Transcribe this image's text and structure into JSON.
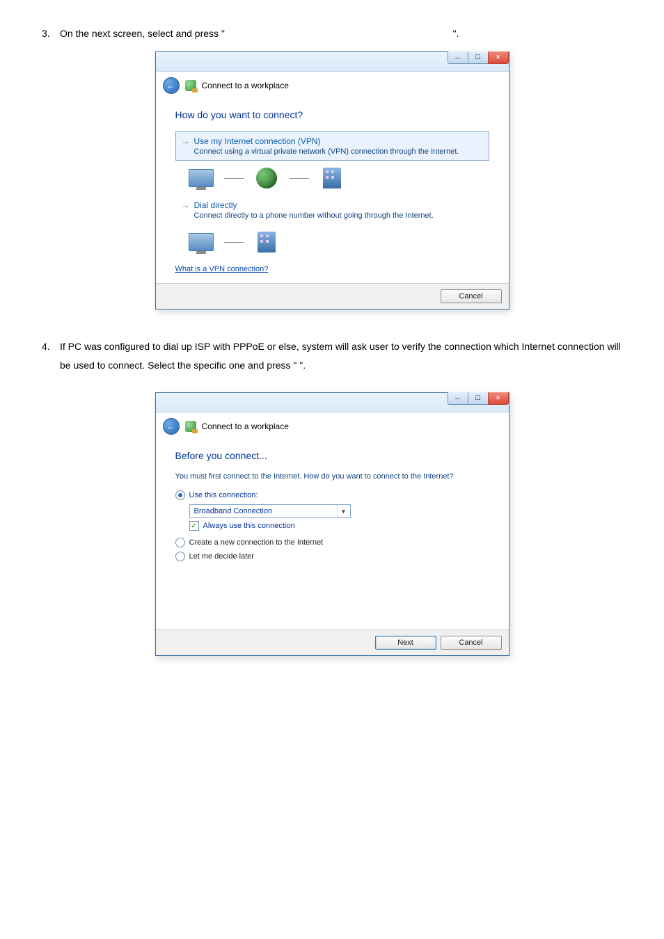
{
  "doc": {
    "item3_num": "3.",
    "item3_text_a": "On the next screen, select and press \"",
    "item3_text_b": "\".",
    "item4_num": "4.",
    "item4_text": "If PC was configured to dial up ISP with PPPoE or else, system will ask user to verify the connection which Internet connection will be used to connect. Select the specific one and press \"        \"."
  },
  "dialog1": {
    "crumb": "Connect to a workplace",
    "heading": "How do you want to connect?",
    "opt1_title": "Use my Internet connection (VPN)",
    "opt1_desc": "Connect using a virtual private network (VPN) connection through the Internet.",
    "opt2_title": "Dial directly",
    "opt2_desc": "Connect directly to a phone number without going through the Internet.",
    "link": "What is a VPN connection?",
    "cancel": "Cancel"
  },
  "dialog2": {
    "crumb": "Connect to a workplace",
    "heading": "Before you connect...",
    "sub": "You must first connect to the Internet. How do you want to connect to the Internet?",
    "r1": "Use this connection:",
    "combo": "Broadband Connection",
    "chk": "Always use this connection",
    "r2": "Create a new connection to the Internet",
    "r3": "Let me decide later",
    "next": "Next",
    "cancel": "Cancel"
  },
  "win": {
    "min": "─",
    "max": "☐",
    "close": "✕"
  }
}
